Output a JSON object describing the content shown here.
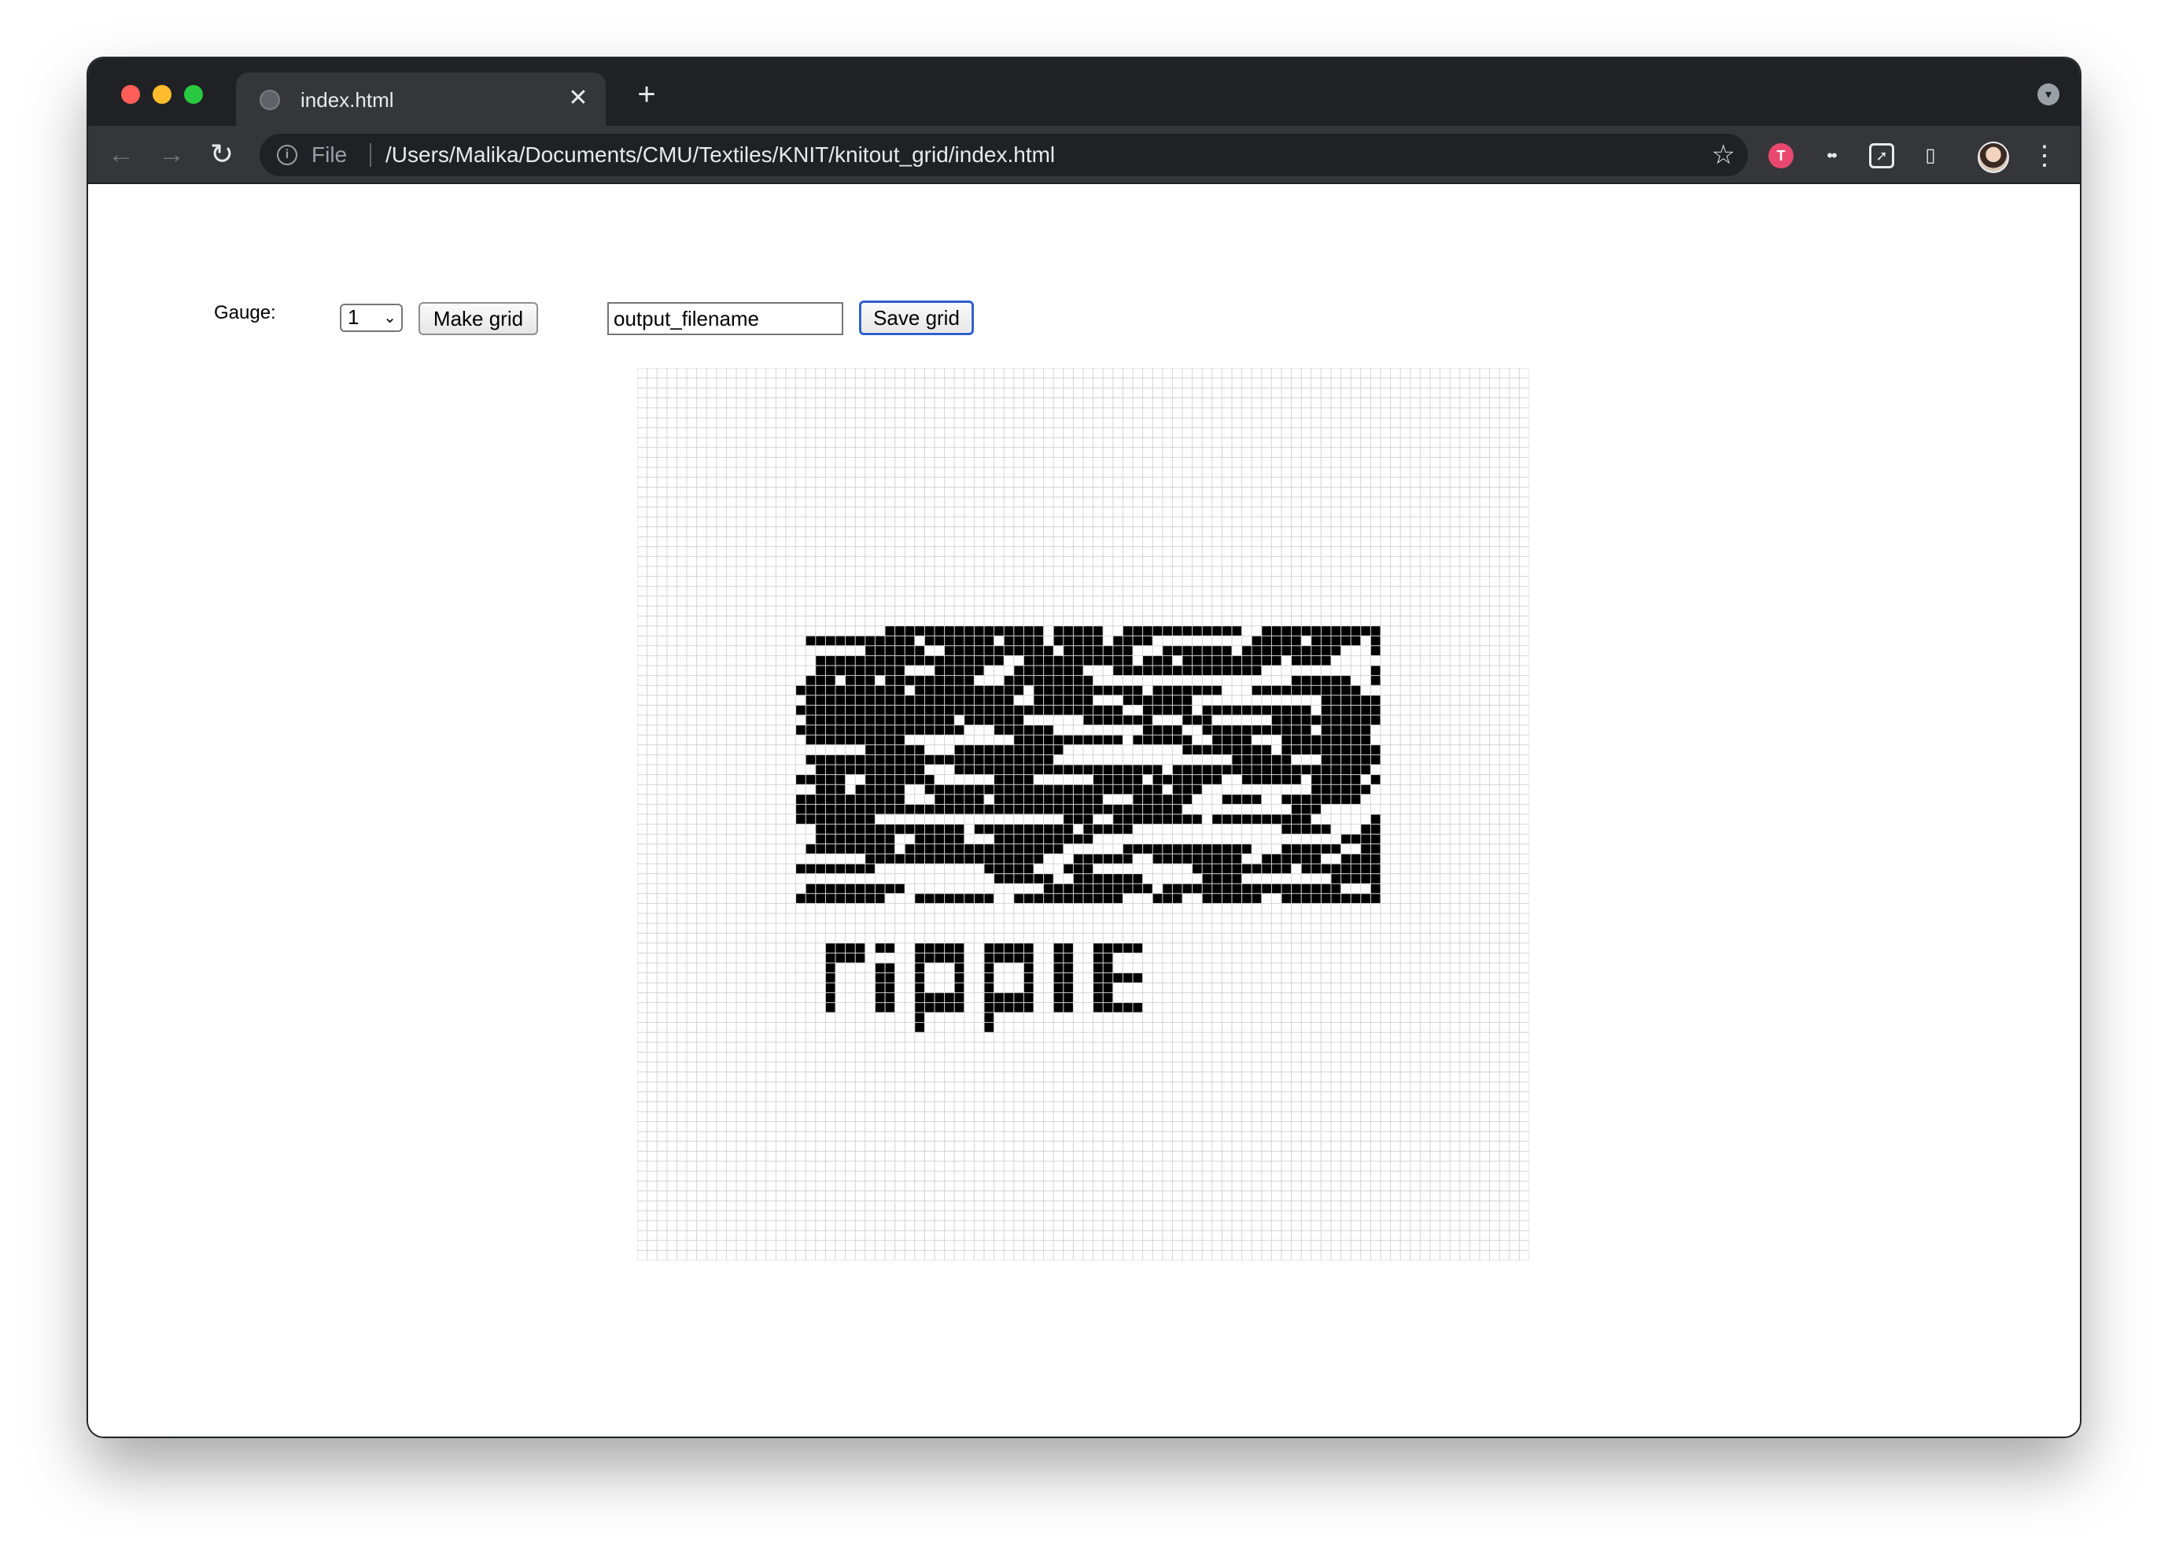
{
  "browser": {
    "tab_title": "index.html",
    "tab_close_icon": "close-icon",
    "new_tab_icon": "plus-icon",
    "scheme_label": "File",
    "url": "/Users/Malika/Documents/CMU/Textiles/KNIT/knitout_grid/index.html"
  },
  "controls": {
    "gauge_label": "Gauge:",
    "gauge_value": "1",
    "make_grid_label": "Make grid",
    "filename_value": "output_filename",
    "save_grid_label": "Save grid"
  },
  "grid": {
    "columns": 90,
    "rows": 90,
    "fill_color": "#000000",
    "line_color": "#d4d4d4",
    "drawn_text": "ripple"
  }
}
